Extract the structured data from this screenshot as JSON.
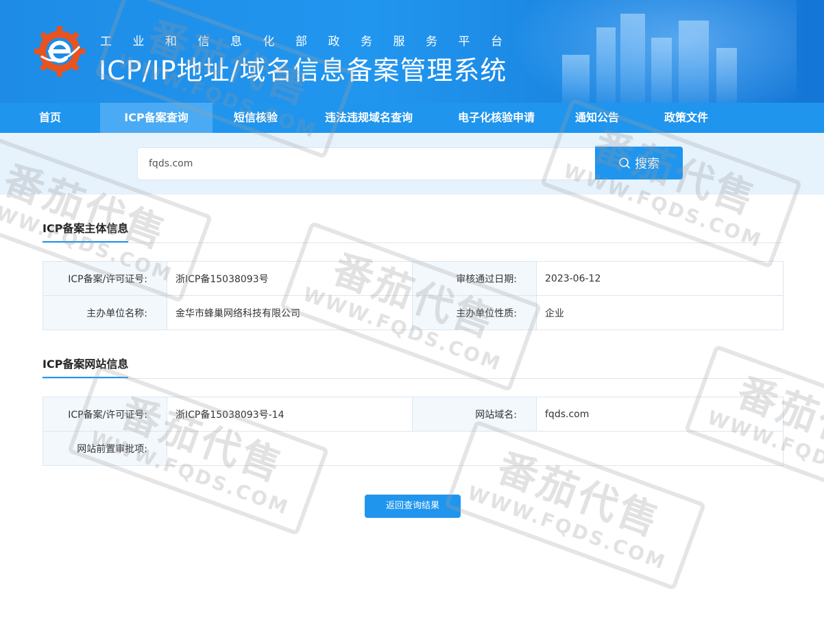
{
  "header": {
    "subtitle": "工业和信息化部政务服务平台",
    "title": "ICP/IP地址/域名信息备案管理系统",
    "logo_icon": "gear-e-logo-icon"
  },
  "nav": {
    "items": [
      {
        "label": "首页"
      },
      {
        "label": "ICP备案查询",
        "active": true
      },
      {
        "label": "短信核验"
      },
      {
        "label": "违法违规域名查询"
      },
      {
        "label": "电子化核验申请"
      },
      {
        "label": "通知公告"
      },
      {
        "label": "政策文件"
      }
    ]
  },
  "search": {
    "value": "fqds.com",
    "button_label": "搜索",
    "button_icon": "search-icon"
  },
  "entity_section": {
    "title": "ICP备案主体信息",
    "rows": [
      {
        "label1": "ICP备案/许可证号:",
        "value1": "浙ICP备15038093号",
        "label2": "审核通过日期:",
        "value2": "2023-06-12"
      },
      {
        "label1": "主办单位名称:",
        "value1": "金华市蜂巢网络科技有限公司",
        "label2": "主办单位性质:",
        "value2": "企业"
      }
    ]
  },
  "website_section": {
    "title": "ICP备案网站信息",
    "rows": [
      {
        "label1": "ICP备案/许可证号:",
        "value1": "浙ICP备15038093号-14",
        "label2": "网站域名:",
        "value2": "fqds.com"
      },
      {
        "label1": "网站前置审批项:",
        "value1": ""
      }
    ]
  },
  "back_button": "返回查询结果",
  "watermark": {
    "big": "番茄代售",
    "small": "WWW.FQDS.COM"
  },
  "colors": {
    "primary": "#1f95ee",
    "nav_active": "#4aaaf3",
    "search_bg": "#e6f2fc",
    "label_bg": "#f3f8fd"
  }
}
